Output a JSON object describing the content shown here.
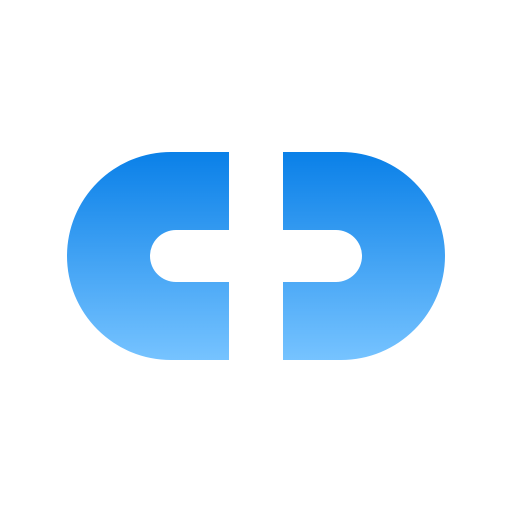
{
  "logo": {
    "name": "link-logo",
    "colors": {
      "background": "#ffffff",
      "gradient_top": "#0a80e8",
      "gradient_bottom": "#76c3ff"
    }
  }
}
